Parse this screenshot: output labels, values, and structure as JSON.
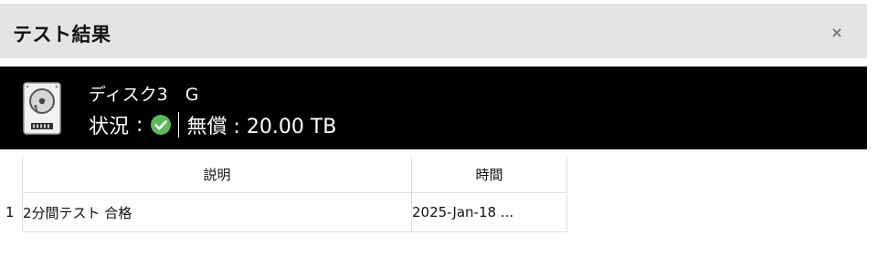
{
  "dialog": {
    "title": "テスト結果",
    "close_label": "×"
  },
  "disk": {
    "name": "ディスク3　G",
    "status_label": "状況",
    "separator": ":",
    "status": "ok",
    "status_icon": "check-circle-icon",
    "status_color": "#5cb85c",
    "health_text": "無償 : 20.00 TB"
  },
  "results": {
    "columns": [
      "説明",
      "時間"
    ],
    "rows": [
      {
        "index": "1",
        "description": "2分間テスト 合格",
        "time": "2025-Jan-18 ..."
      }
    ]
  }
}
